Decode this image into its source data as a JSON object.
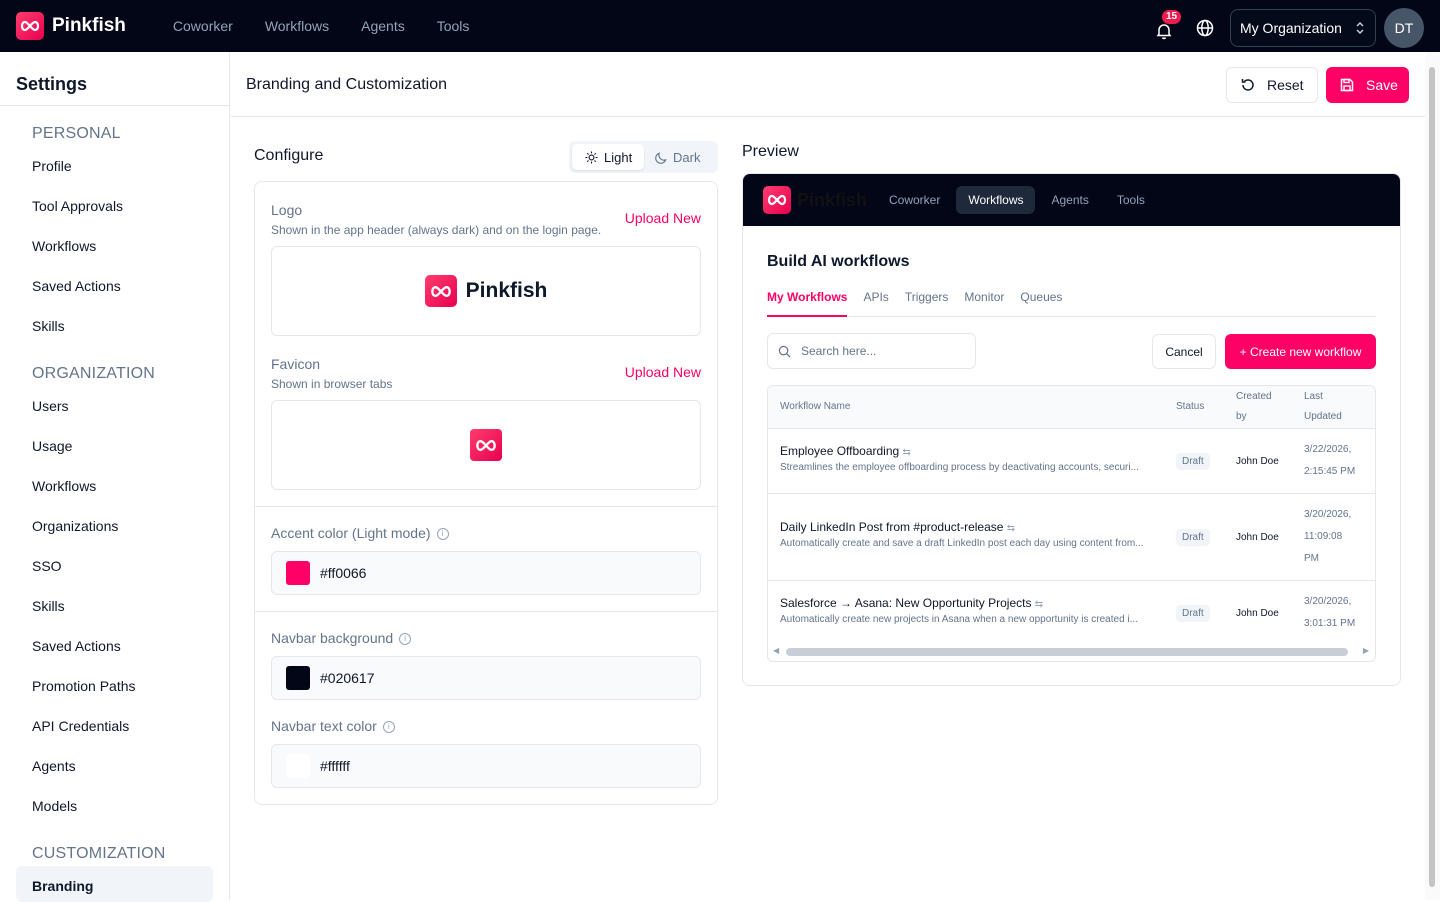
{
  "topbar": {
    "brand": "Pinkfish",
    "nav": [
      "Coworker",
      "Workflows",
      "Agents",
      "Tools"
    ],
    "notification_count": "15",
    "org_selector": "My Organization",
    "avatar_initials": "DT"
  },
  "sidebar": {
    "title": "Settings",
    "personal_head": "PERSONAL",
    "personal": [
      "Profile",
      "Tool Approvals",
      "Workflows",
      "Saved Actions",
      "Skills"
    ],
    "org_head": "ORGANIZATION",
    "org": [
      "Users",
      "Usage",
      "Workflows",
      "Organizations",
      "SSO",
      "Skills",
      "Saved Actions",
      "Promotion Paths",
      "API Credentials",
      "Agents",
      "Models"
    ],
    "custom_head": "CUSTOMIZATION",
    "custom": [
      "Branding"
    ]
  },
  "header": {
    "title": "Branding and Customization",
    "reset_label": "Reset",
    "save_label": "Save"
  },
  "configure": {
    "label": "Configure",
    "mode_light": "Light",
    "mode_dark": "Dark",
    "logo_label": "Logo",
    "logo_sub": "Shown in the app header (always dark) and on the login page.",
    "logo_brand": "Pinkfish",
    "upload_label": "Upload New",
    "favicon_label": "Favicon",
    "favicon_sub": "Shown in browser tabs",
    "accent_label": "Accent color (Light mode)",
    "accent_value": "#ff0066",
    "navbar_bg_label": "Navbar background",
    "navbar_bg_value": "#020617",
    "navbar_text_label": "Navbar text color",
    "navbar_text_value": "#ffffff"
  },
  "preview": {
    "label": "Preview",
    "brand": "Pinkfish",
    "nav": [
      "Coworker",
      "Workflows",
      "Agents",
      "Tools"
    ],
    "active_nav": "Workflows",
    "heading": "Build AI workflows",
    "tabs": [
      "My Workflows",
      "APIs",
      "Triggers",
      "Monitor",
      "Queues"
    ],
    "search_placeholder": "Search here...",
    "cancel_label": "Cancel",
    "create_label": "+ Create new workflow",
    "columns": {
      "name": "Workflow Name",
      "status": "Status",
      "created_by_1": "Created",
      "created_by_2": "by",
      "updated_1": "Last",
      "updated_2": "Updated"
    },
    "rows": [
      {
        "name": "Employee Offboarding",
        "desc": "Streamlines the employee offboarding process by deactivating accounts, securi...",
        "status": "Draft",
        "creator": "John Doe",
        "updated_1": "3/22/2026,",
        "updated_2": "2:15:45 PM",
        "updated_3": ""
      },
      {
        "name": "Daily LinkedIn Post from #product-release",
        "desc": "Automatically create and save a draft LinkedIn post each day using content from...",
        "status": "Draft",
        "creator": "John Doe",
        "updated_1": "3/20/2026,",
        "updated_2": "11:09:08",
        "updated_3": "PM"
      },
      {
        "name": "Salesforce → Asana: New Opportunity Projects",
        "desc": "Automatically create new projects in Asana when a new opportunity is created i...",
        "status": "Draft",
        "creator": "John Doe",
        "updated_1": "3/20/2026,",
        "updated_2": "3:01:31 PM",
        "updated_3": ""
      }
    ]
  },
  "colors": {
    "accent": "#ff0066",
    "navbar": "#020617",
    "navbar_text": "#ffffff"
  }
}
